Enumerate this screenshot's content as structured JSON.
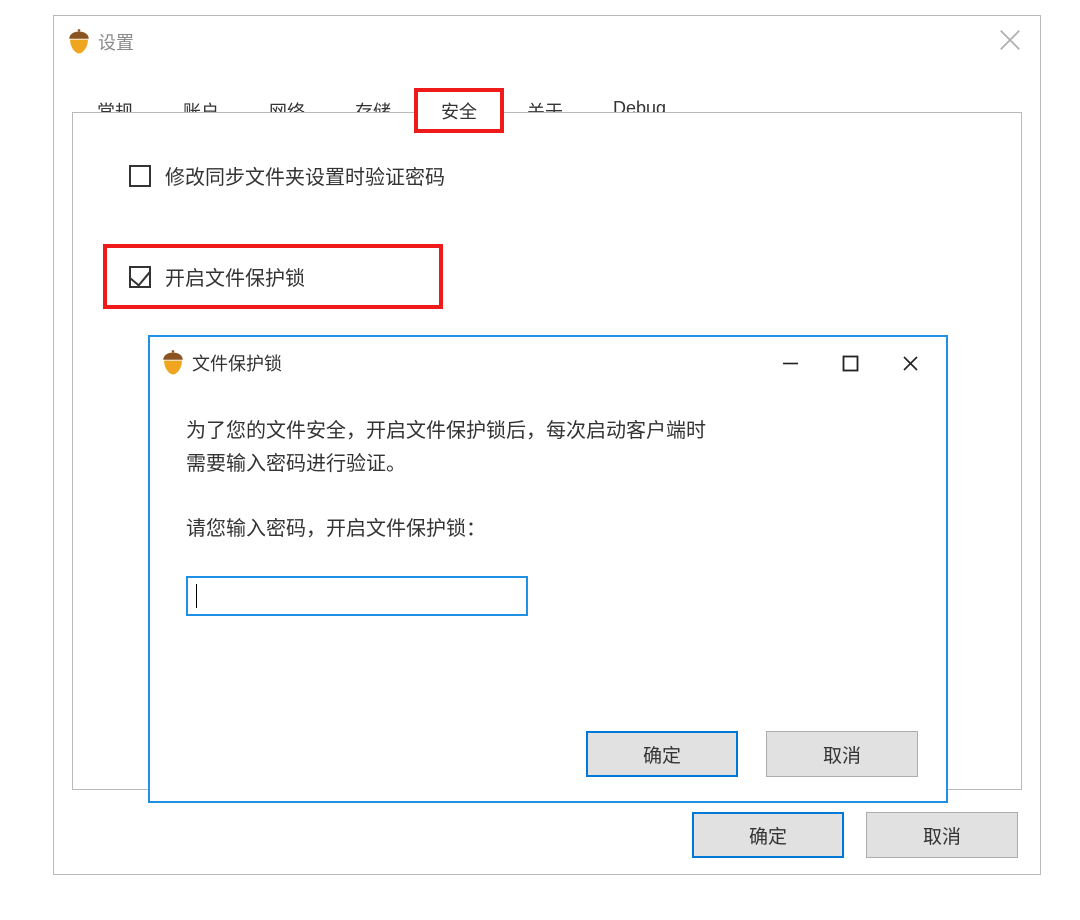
{
  "settings_window": {
    "title": "设置",
    "tabs": {
      "general": "常规",
      "account": "账户",
      "network": "网络",
      "storage": "存储",
      "security": "安全",
      "about": "关于",
      "debug": "Debug"
    },
    "options": {
      "verify_on_sync_change": "修改同步文件夹设置时验证密码",
      "enable_file_lock": "开启文件保护锁"
    },
    "buttons": {
      "ok": "确定",
      "cancel": "取消"
    }
  },
  "dialog": {
    "title": "文件保护锁",
    "line1": "为了您的文件安全，开启文件保护锁后，每次启动客户端时",
    "line2": "需要输入密码进行验证。",
    "prompt": "请您输入密码，开启文件保护锁：",
    "password_value": "",
    "buttons": {
      "ok": "确定",
      "cancel": "取消"
    }
  }
}
